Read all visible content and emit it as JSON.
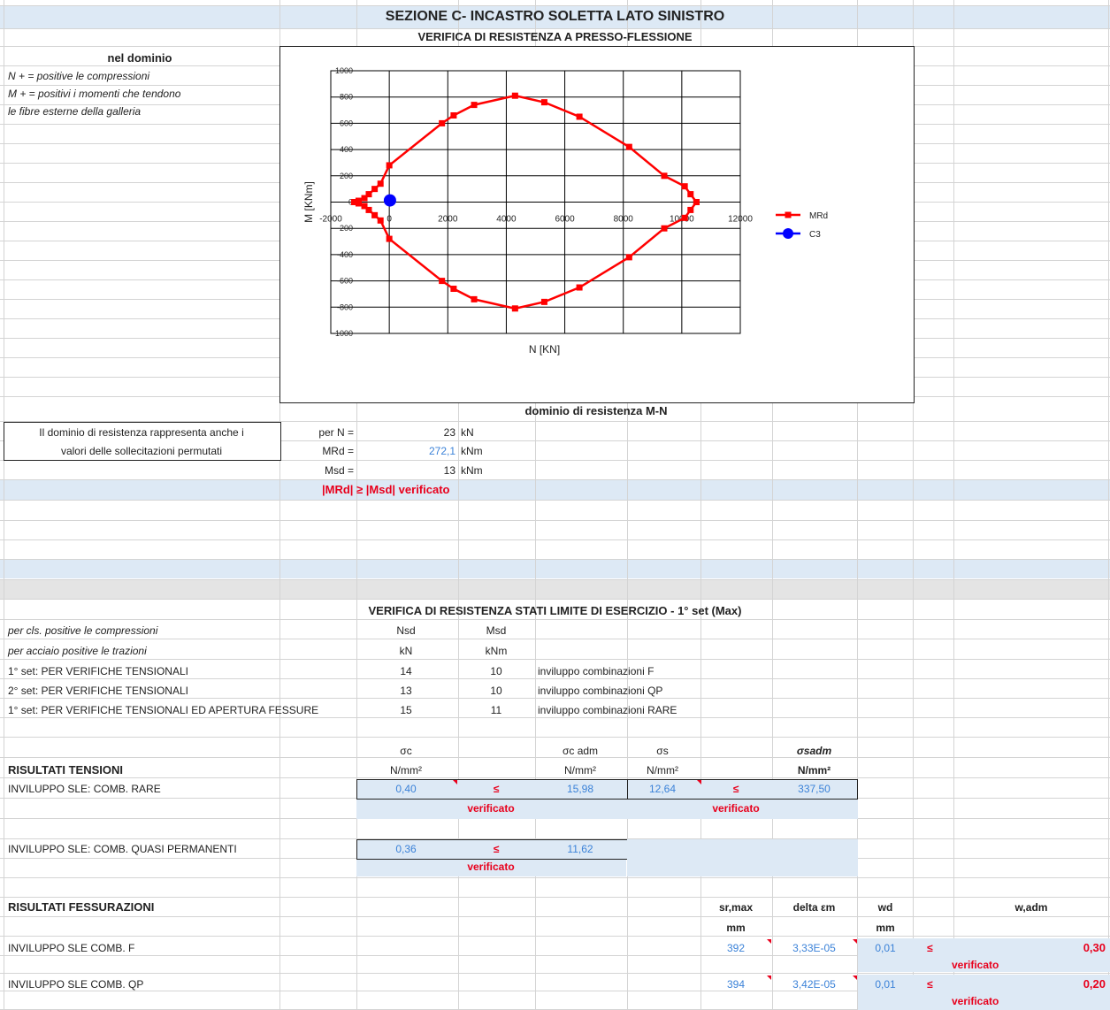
{
  "header": {
    "title": "SEZIONE C- INCASTRO  SOLETTA LATO SINISTRO",
    "subtitle": "VERIFICA DI RESISTENZA A PRESSO-FLESSIONE"
  },
  "domain_notes": {
    "heading": "nel dominio",
    "line1": "N + =  positive le compressioni",
    "line2": "M + =  positivi  i momenti che tendono",
    "line3": " le fibre esterne della galleria"
  },
  "chart_data": {
    "type": "scatter",
    "title": "",
    "xlabel": "N [KN]",
    "ylabel": "M [KNm]",
    "xlim": [
      -2000,
      12000
    ],
    "ylim": [
      -1000,
      1000
    ],
    "x_ticks": [
      "-2000",
      "0",
      "2000",
      "4000",
      "6000",
      "8000",
      "10000",
      "12000"
    ],
    "y_ticks": [
      "1000",
      "800",
      "600",
      "400",
      "200",
      "0",
      "-200",
      "-400",
      "-600",
      "-800",
      "-1000"
    ],
    "series": [
      {
        "name": "MRd",
        "color": "#ff0000",
        "x": [
          10500,
          10300,
          10100,
          9400,
          8200,
          6500,
          5300,
          4300,
          2900,
          2200,
          1800,
          0,
          -300,
          -500,
          -700,
          -850,
          -1050,
          -1200,
          -1050,
          -850,
          -700,
          -500,
          -300,
          0,
          1800,
          2200,
          2900,
          4300,
          5300,
          6500,
          8200,
          9400,
          10100,
          10300,
          10500
        ],
        "y": [
          0,
          60,
          120,
          200,
          420,
          650,
          760,
          810,
          740,
          660,
          600,
          280,
          140,
          100,
          60,
          30,
          10,
          0,
          -10,
          -30,
          -60,
          -100,
          -140,
          -280,
          -600,
          -660,
          -740,
          -810,
          -760,
          -650,
          -420,
          -200,
          -120,
          -60,
          0
        ]
      },
      {
        "name": "C3",
        "color": "#0000ff",
        "x": [
          23
        ],
        "y": [
          13
        ]
      }
    ],
    "grid": true,
    "legend": "right"
  },
  "chart_caption": "dominio di resistenza M-N",
  "resistance": {
    "desc1": "Il dominio di resistenza rappresenta anche i",
    "desc2": "valori delle sollecitazioni permutati",
    "rows": [
      {
        "label": "per N =",
        "value": "23",
        "unit": "kN"
      },
      {
        "label": "MRd =",
        "value": "272,1",
        "unit": "kNm"
      },
      {
        "label": "Msd =",
        "value": "13",
        "unit": "kNm"
      }
    ],
    "result": "|MRd| ≥ |Msd| verificato"
  },
  "sle": {
    "title": "VERIFICA DI RESISTENZA STATI LIMITE DI ESERCIZIO - 1° set (Max)",
    "note1": "per cls. positive le compressioni",
    "note2": "per acciaio positive le trazioni",
    "col_nsd": "Nsd",
    "col_msd": "Msd",
    "unit_kn": "kN",
    "unit_knm": "kNm",
    "rows": [
      {
        "label": "1° set: PER VERIFICHE TENSIONALI",
        "nsd": "14",
        "msd": "10",
        "desc": "inviluppo combinazioni F"
      },
      {
        "label": "2° set: PER VERIFICHE TENSIONALI",
        "nsd": "13",
        "msd": "10",
        "desc": "inviluppo combinazioni QP"
      },
      {
        "label": "1° set: PER VERIFICHE TENSIONALI ED APERTURA FESSURE",
        "nsd": "15",
        "msd": "11",
        "desc": "inviluppo combinazioni RARE"
      }
    ]
  },
  "tensions": {
    "h_sc": "σc",
    "h_scadm": "σc adm",
    "h_ss": "σs",
    "h_ssadm": "σsadm",
    "title": "RISULTATI TENSIONI",
    "unit": "N/mm²",
    "rare_label": "INVILUPPO SLE: COMB. RARE",
    "rare_sc": "0,40",
    "rare_scadm": "15,98",
    "rare_ss": "12,64",
    "rare_ssadm": "337,50",
    "leq": "≤",
    "ok": "verificato",
    "qp_label": "INVILUPPO SLE: COMB. QUASI PERMANENTI",
    "qp_sc": "0,36",
    "qp_scadm": "11,62"
  },
  "cracks": {
    "title": "RISULTATI FESSURAZIONI",
    "h_sr": "sr,max",
    "h_de": "delta εm",
    "h_wd": "wd",
    "h_wadm": "w,adm",
    "unit_mm": "mm",
    "f_label": "INVILUPPO SLE COMB. F",
    "f_sr": "392",
    "f_de": "3,33E-05",
    "f_wd": "0,01",
    "f_wadm": "0,30",
    "qp_label": "INVILUPPO SLE COMB. QP",
    "qp_sr": "394",
    "qp_de": "3,42E-05",
    "qp_wd": "0,01",
    "qp_wadm": "0,20",
    "leq": "≤",
    "ok": "verificato"
  }
}
